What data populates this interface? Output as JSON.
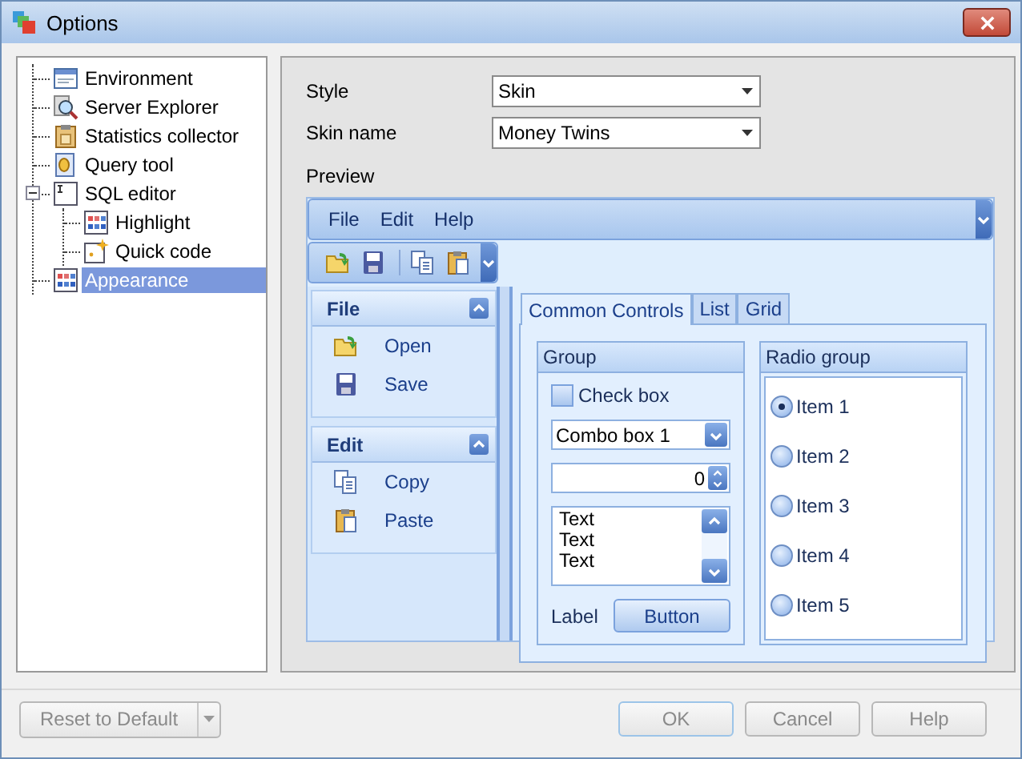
{
  "window": {
    "title": "Options"
  },
  "tree": [
    {
      "label": "Environment",
      "selected": false
    },
    {
      "label": "Server Explorer",
      "selected": false
    },
    {
      "label": "Statistics collector",
      "selected": false
    },
    {
      "label": "Query tool",
      "selected": false
    },
    {
      "label": "SQL editor",
      "selected": false,
      "expanded": true,
      "children": [
        {
          "label": "Highlight",
          "selected": false
        },
        {
          "label": "Quick code",
          "selected": false
        }
      ]
    },
    {
      "label": "Appearance",
      "selected": true
    }
  ],
  "settings": [
    {
      "label": "Style",
      "value": "Skin"
    },
    {
      "label": "Skin name",
      "value": "Money Twins"
    }
  ],
  "preview": {
    "label": "Preview",
    "menu": [
      "File",
      "Edit",
      "Help"
    ],
    "nav_groups": [
      {
        "title": "File",
        "items": [
          "Open",
          "Save"
        ]
      },
      {
        "title": "Edit",
        "items": [
          "Copy",
          "Paste"
        ]
      }
    ],
    "tabs": [
      {
        "label": "Common Controls",
        "selected": true
      },
      {
        "label": "List",
        "selected": false
      },
      {
        "label": "Grid",
        "selected": false
      }
    ],
    "group": {
      "title": "Group",
      "checkbox": {
        "label": "Check box",
        "checked": false
      },
      "combo": "Combo box 1",
      "spin": "0",
      "memo_lines": [
        "Text",
        "Text",
        "Text"
      ],
      "label": "Label",
      "button": "Button"
    },
    "radio_group": {
      "title": "Radio group",
      "items": [
        {
          "label": "Item 1",
          "selected": true
        },
        {
          "label": "Item 2",
          "selected": false
        },
        {
          "label": "Item 3",
          "selected": false
        },
        {
          "label": "Item 4",
          "selected": false
        },
        {
          "label": "Item 5",
          "selected": false
        }
      ]
    }
  },
  "footer": {
    "reset": {
      "label": "Reset to Default",
      "disabled": true
    },
    "buttons": [
      {
        "label": "OK",
        "disabled": true
      },
      {
        "label": "Cancel",
        "disabled": true
      },
      {
        "label": "Help",
        "disabled": true
      }
    ]
  }
}
